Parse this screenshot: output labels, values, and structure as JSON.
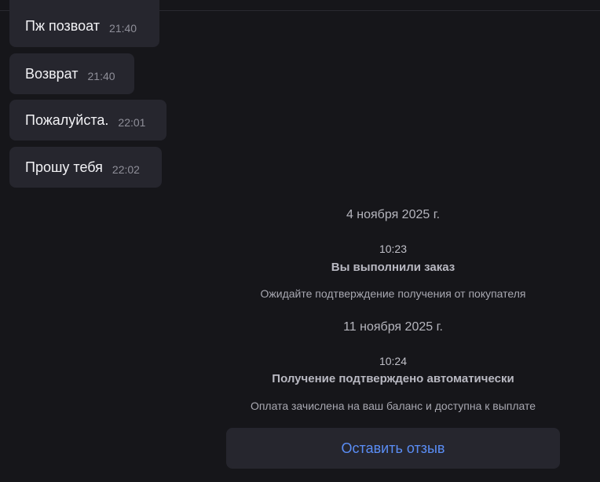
{
  "messages": [
    {
      "text": "Пж позвоат",
      "time": "21:40"
    },
    {
      "text": "Возврат",
      "time": "21:40"
    },
    {
      "text": "Пожалуйста.",
      "time": "22:01"
    },
    {
      "text": "Прошу тебя",
      "time": "22:02"
    }
  ],
  "events": [
    {
      "date": "4 ноября 2025 г.",
      "time": "10:23",
      "title": "Вы выполнили заказ",
      "description": "Ожидайте подтверждение получения от покупателя"
    },
    {
      "date": "11 ноября 2025 г.",
      "time": "10:24",
      "title": "Получение подтверждено автоматически",
      "description": "Оплата зачислена на ваш баланс и доступна к выплате"
    }
  ],
  "review_button": {
    "label": "Оставить отзыв"
  },
  "colors": {
    "background": "#16161a",
    "bubble": "#26262e",
    "accent": "#5a8df5"
  }
}
